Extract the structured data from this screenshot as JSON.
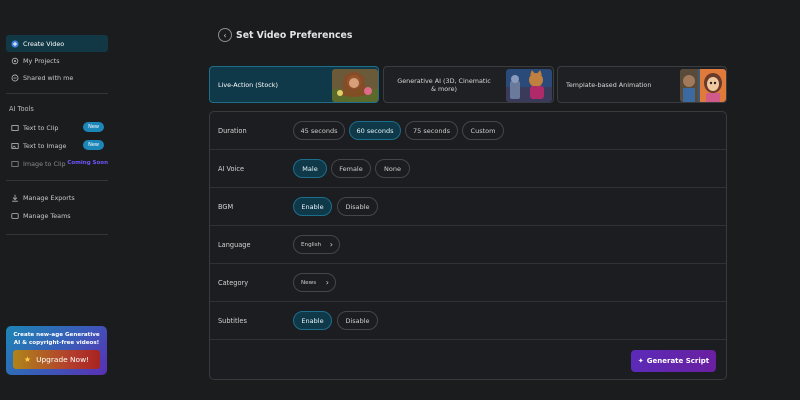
{
  "sidebar": {
    "nav": [
      {
        "label": "Create Video",
        "icon": "plus-circle-icon"
      },
      {
        "label": "My Projects",
        "icon": "gear-icon"
      },
      {
        "label": "Shared with me",
        "icon": "share-icon"
      }
    ],
    "ai_tools_label": "AI Tools",
    "tools": [
      {
        "label": "Text to Clip",
        "badge": "New",
        "icon": "clip-icon"
      },
      {
        "label": "Text to Image",
        "badge": "New",
        "icon": "image-icon"
      },
      {
        "label": "Image to Clip",
        "badge": "Coming Soon",
        "icon": "image-clip-icon"
      }
    ],
    "manage": [
      {
        "label": "Manage Exports",
        "icon": "export-icon"
      },
      {
        "label": "Manage Teams",
        "icon": "team-icon"
      }
    ],
    "promo": {
      "text": "Create new-age Generative AI & copyright-free videos!",
      "button": "Upgrade Now!"
    }
  },
  "header": {
    "title": "Set Video Preferences"
  },
  "video_types": [
    {
      "label": "Live-Action (Stock)",
      "selected": true
    },
    {
      "label": "Generative AI (3D, Cinematic & more)",
      "selected": false
    },
    {
      "label": "Template-based Animation",
      "selected": false
    }
  ],
  "preferences": {
    "duration": {
      "label": "Duration",
      "options": [
        "45 seconds",
        "60 seconds",
        "75 seconds",
        "Custom"
      ],
      "selected": "60 seconds"
    },
    "voice": {
      "label": "AI Voice",
      "options": [
        "Male",
        "Female",
        "None"
      ],
      "selected": "Male"
    },
    "bgm": {
      "label": "BGM",
      "options": [
        "Enable",
        "Disable"
      ],
      "selected": "Enable"
    },
    "language": {
      "label": "Language",
      "value": "English"
    },
    "category": {
      "label": "Category",
      "value": "News"
    },
    "subtitles": {
      "label": "Subtitles",
      "options": [
        "Enable",
        "Disable"
      ],
      "selected": "Enable"
    }
  },
  "actions": {
    "generate": "Generate Script"
  },
  "colors": {
    "accent": "#0f3948",
    "accent_border": "#1b6e8c",
    "badge": "#1b86b7",
    "primary_button": "#5b2bb8"
  }
}
